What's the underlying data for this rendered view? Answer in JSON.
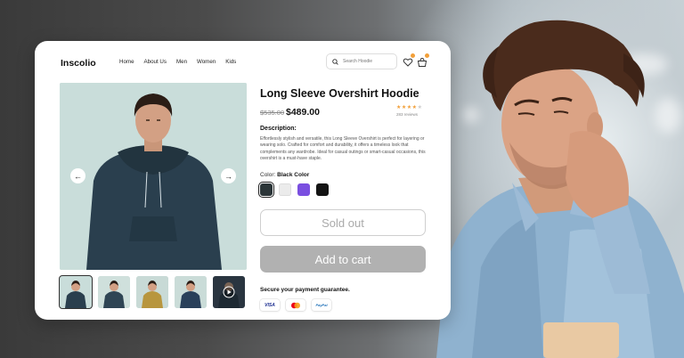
{
  "brand": {
    "name": "Inscolio"
  },
  "nav": {
    "items": [
      "Home",
      "About Us",
      "Men",
      "Women",
      "Kids"
    ]
  },
  "search": {
    "placeholder": "Search Hoodie"
  },
  "product": {
    "title": "Long Sleeve Overshirt Hoodie",
    "old_price": "$535.00",
    "price": "$489.00",
    "rating": 4,
    "rating_max": 5,
    "reviews": "283 reviews",
    "description_heading": "Description:",
    "description": "Effortlessly stylish and versatile, this Long Sleeve Overshirt is perfect for layering or wearing solo. Crafted for comfort and durability, it offers a timeless look that complements any wardrobe. Ideal for casual outings or smart-casual occasions, this overshirt is a must-have staple.",
    "color_label": "Color:",
    "color_value": "Black Color",
    "swatches": [
      "#2b3538",
      "#ebebeb",
      "#7a4fe0",
      "#141414"
    ],
    "sold_out_label": "Sold out",
    "add_to_cart_label": "Add to cart"
  },
  "payment": {
    "heading": "Secure your payment guarantee.",
    "methods": [
      "VISA",
      "mastercard",
      "PayPal"
    ]
  },
  "colors": {
    "accent": "#f2a03a",
    "hoodie": "#2a3f4e",
    "image_bg": "#c8ddd9",
    "disabled_button": "#b1b1b1"
  }
}
